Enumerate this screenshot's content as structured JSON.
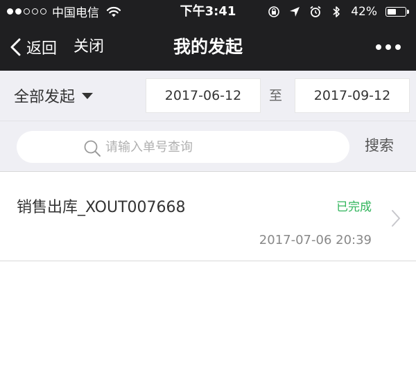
{
  "status_bar": {
    "carrier": "中国电信",
    "time": "下午3:41",
    "battery_percent": "42%",
    "battery_level": 0.42,
    "signal_strength": 2,
    "signal_total": 5
  },
  "nav": {
    "back_label": "返回",
    "close_label": "关闭",
    "title": "我的发起",
    "more_icon": "more-dots-icon"
  },
  "filter": {
    "type_label": "全部发起",
    "start_date": "2017-06-12",
    "separator": "至",
    "end_date": "2017-09-12"
  },
  "search": {
    "placeholder": "请输入单号查询",
    "value": "",
    "button_label": "搜索"
  },
  "list": {
    "items": [
      {
        "title": "销售出库_XOUT007668",
        "status": "已完成",
        "datetime": "2017-07-06 20:39"
      }
    ]
  },
  "colors": {
    "bar_background": "#1f1f21",
    "page_background": "#efeff4",
    "status_completed": "#2fb45a"
  }
}
